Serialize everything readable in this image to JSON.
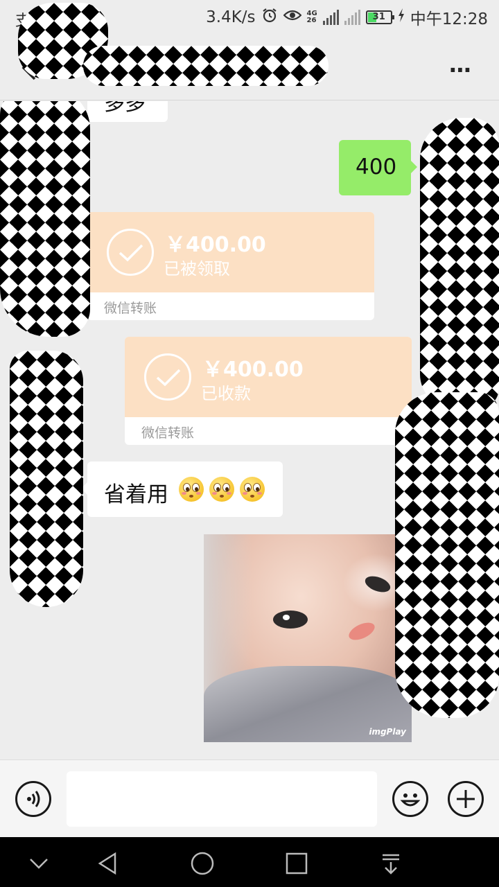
{
  "status_bar": {
    "app_glyph": "支",
    "speed": "3.4K/s",
    "net_top": "4G",
    "net_bottom": "26",
    "battery": "31",
    "time": "中午12:28"
  },
  "header": {
    "title": "",
    "more_label": "⋯"
  },
  "messages": [
    {
      "side": "left",
      "type": "text",
      "text": "多多",
      "partial": true
    },
    {
      "side": "right",
      "type": "text",
      "text": "400"
    },
    {
      "side": "left",
      "type": "transfer",
      "amount": "￥400.00",
      "status": "已被领取",
      "label": "微信转账"
    },
    {
      "side": "right",
      "type": "transfer",
      "amount": "￥400.00",
      "status": "已收款",
      "label": "微信转账"
    },
    {
      "side": "left",
      "type": "text",
      "text": "省着用",
      "emoji": [
        "flushed-face",
        "flushed-face",
        "flushed-face"
      ]
    },
    {
      "side": "right",
      "type": "image",
      "watermark": "imgPlay"
    }
  ],
  "colors": {
    "sent_bubble": "#95ec69",
    "transfer_bg": "#fce0c4",
    "background": "#ededed"
  }
}
